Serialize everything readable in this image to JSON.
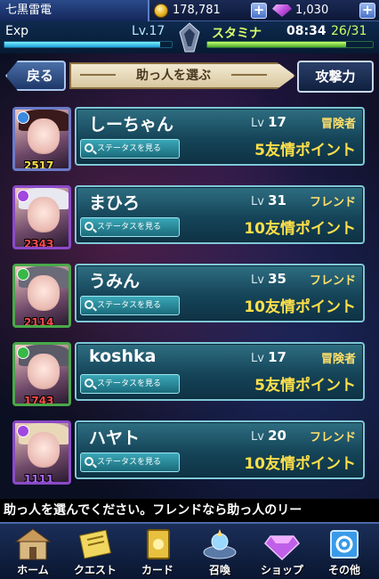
{
  "top": {
    "player_name": "七黒雷電",
    "coins": "178,781",
    "gems": "1,030",
    "plus": "+"
  },
  "stats": {
    "exp_label": "Exp",
    "level": "Lv.17",
    "exp_progress": 0.93,
    "stamina_label": "スタミナ",
    "stamina_timer": "08:34",
    "stamina_count": "26/31",
    "stamina_progress": 0.84
  },
  "header": {
    "back_label": "戻る",
    "title": "助っ人を選ぶ",
    "attack_label": "攻撃力"
  },
  "status_button_label": "ステータスを見る",
  "lv_prefix": "Lv",
  "helpers": [
    {
      "name": "しーちゃん",
      "level": "17",
      "relation": "冒険者",
      "points": "5友情ポイント",
      "attack": "2517",
      "attack_color": "#ffe04a",
      "frame": "#6a7ac8",
      "badge": "#3a8ae0"
    },
    {
      "name": "まひろ",
      "level": "31",
      "relation": "フレンド",
      "points": "10友情ポイント",
      "attack": "2343",
      "attack_color": "#ff4a4a",
      "frame": "#8a4ac8",
      "badge": "#a048e0"
    },
    {
      "name": "うみん",
      "level": "35",
      "relation": "フレンド",
      "points": "10友情ポイント",
      "attack": "2114",
      "attack_color": "#ff4a4a",
      "frame": "#4aa84a",
      "badge": "#38b848"
    },
    {
      "name": "koshka",
      "level": "17",
      "relation": "冒険者",
      "points": "5友情ポイント",
      "attack": "1743",
      "attack_color": "#ff4a4a",
      "frame": "#4aa84a",
      "badge": "#38b848"
    },
    {
      "name": "ハヤト",
      "level": "20",
      "relation": "フレンド",
      "points": "10友情ポイント",
      "attack": "1111",
      "attack_color": "#b06aff",
      "frame": "#8a4ac8",
      "badge": "#a048e0"
    }
  ],
  "ticker": "助っ人を選んでください。フレンドなら助っ人のリー",
  "nav": [
    {
      "label": "ホーム",
      "icon": "home-icon"
    },
    {
      "label": "クエスト",
      "icon": "quest-icon"
    },
    {
      "label": "カード",
      "icon": "card-icon"
    },
    {
      "label": "召喚",
      "icon": "summon-icon"
    },
    {
      "label": "ショップ",
      "icon": "shop-icon"
    },
    {
      "label": "その他",
      "icon": "other-icon"
    }
  ]
}
